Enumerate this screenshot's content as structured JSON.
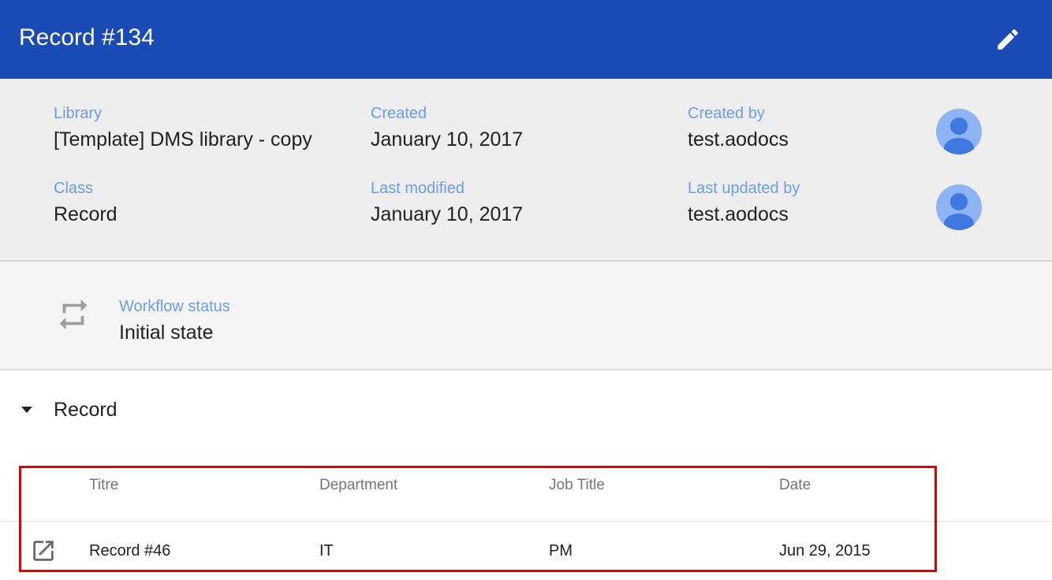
{
  "header": {
    "title": "Record #134",
    "edit_icon": "pencil-icon"
  },
  "meta": {
    "library": {
      "label": "Library",
      "value": "[Template] DMS library - copy"
    },
    "created": {
      "label": "Created",
      "value": "January 10, 2017"
    },
    "created_by": {
      "label": "Created by",
      "value": "test.aodocs"
    },
    "class": {
      "label": "Class",
      "value": "Record"
    },
    "last_modified": {
      "label": "Last modified",
      "value": "January 10, 2017"
    },
    "last_updated_by": {
      "label": "Last updated by",
      "value": "test.aodocs"
    }
  },
  "workflow": {
    "icon": "repeat-icon",
    "label": "Workflow status",
    "value": "Initial state"
  },
  "section": {
    "title": "Record",
    "expanded": true
  },
  "table": {
    "columns": [
      "Titre",
      "Department",
      "Job Title",
      "Date"
    ],
    "rows": [
      {
        "titre": "Record #46",
        "department": "IT",
        "job_title": "PM",
        "date": "Jun 29, 2015"
      }
    ]
  },
  "colors": {
    "header_bg": "#1a4bb4",
    "label": "#6d9cf0",
    "avatar_bg": "#8fb4f5",
    "avatar_fg": "#3f78e0",
    "highlight": "#e10000"
  }
}
